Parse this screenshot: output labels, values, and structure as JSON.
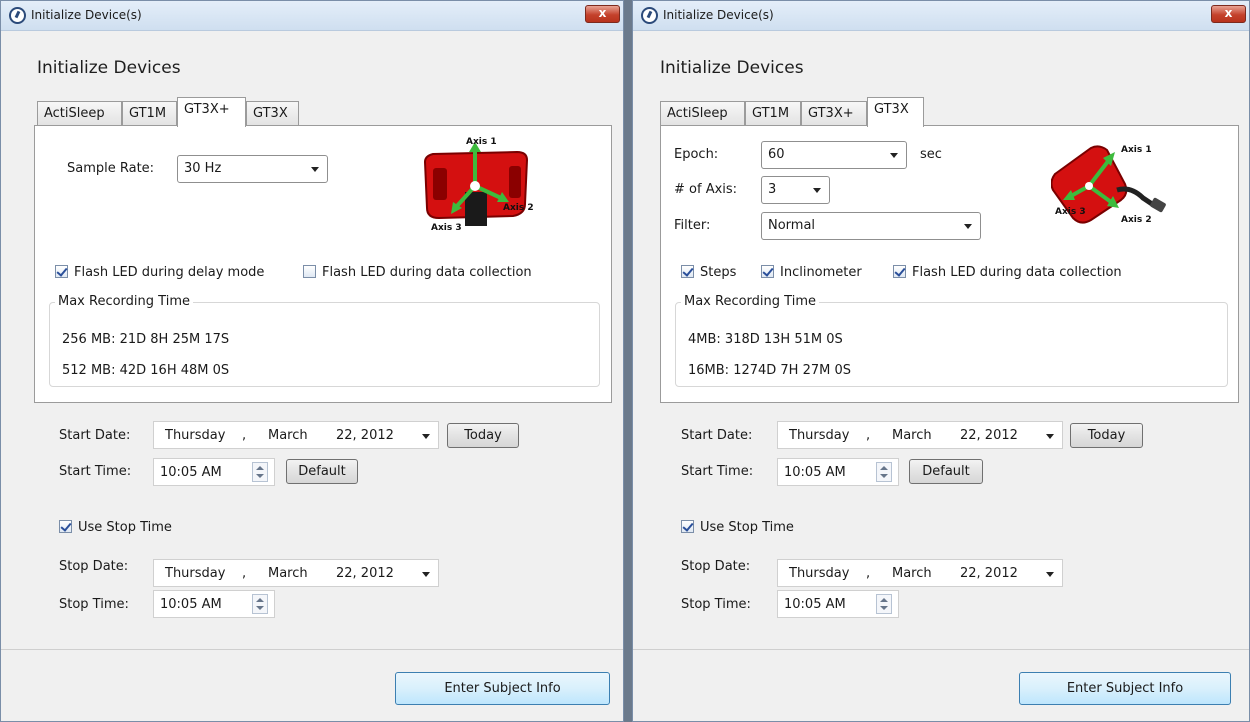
{
  "colors": {
    "accent": "#2a4f9a",
    "device_red": "#d41010",
    "axis_green": "#3dbb3d"
  },
  "icons": {
    "app": "actigraph-logo-icon",
    "close": "close-icon",
    "device": "device-axes-image"
  },
  "windows": [
    {
      "title": "Initialize Device(s)",
      "close": "x",
      "heading": "Initialize Devices",
      "tabs": [
        "ActiSleep",
        "GT1M",
        "GT3X+",
        "GT3X"
      ],
      "active_tab": "GT3X+",
      "settings": {
        "sample_rate_label": "Sample Rate:",
        "sample_rate_value": "30 Hz"
      },
      "device_axes": {
        "axis1": "Axis 1",
        "axis2": "Axis 2",
        "axis3": "Axis 3"
      },
      "checkboxes": [
        {
          "label": "Flash LED during delay mode",
          "checked": true
        },
        {
          "label": "Flash LED during data collection",
          "checked": false
        }
      ],
      "max_recording": {
        "title": "Max Recording Time",
        "lines": [
          "256 MB: 21D 8H 25M 17S",
          "512 MB: 42D 16H 48M 0S"
        ]
      },
      "start_date": {
        "label": "Start Date:",
        "day": "Thursday",
        "sep": ",",
        "month": "March",
        "date": "22, 2012",
        "button": "Today"
      },
      "start_time": {
        "label": "Start Time:",
        "value": "10:05 AM",
        "button": "Default"
      },
      "use_stop_time": {
        "label": "Use Stop Time",
        "checked": true
      },
      "stop_date": {
        "label": "Stop Date:",
        "day": "Thursday",
        "sep": ",",
        "month": "March",
        "date": "22, 2012"
      },
      "stop_time": {
        "label": "Stop Time:",
        "value": "10:05 AM"
      },
      "enter_button": "Enter Subject Info"
    },
    {
      "title": "Initialize Device(s)",
      "close": "x",
      "heading": "Initialize Devices",
      "tabs": [
        "ActiSleep",
        "GT1M",
        "GT3X+",
        "GT3X"
      ],
      "active_tab": "GT3X",
      "settings": {
        "epoch_label": "Epoch:",
        "epoch_value": "60",
        "epoch_unit": "sec",
        "axis_label": "# of Axis:",
        "axis_value": "3",
        "filter_label": "Filter:",
        "filter_value": "Normal"
      },
      "device_axes": {
        "axis1": "Axis 1",
        "axis2": "Axis 2",
        "axis3": "Axis 3"
      },
      "checkboxes": [
        {
          "label": "Steps",
          "checked": true
        },
        {
          "label": "Inclinometer",
          "checked": true
        },
        {
          "label": "Flash LED during data collection",
          "checked": true
        }
      ],
      "max_recording": {
        "title": "Max Recording Time",
        "lines": [
          "4MB: 318D 13H 51M 0S",
          "16MB: 1274D 7H 27M 0S"
        ]
      },
      "start_date": {
        "label": "Start Date:",
        "day": "Thursday",
        "sep": ",",
        "month": "March",
        "date": "22, 2012",
        "button": "Today"
      },
      "start_time": {
        "label": "Start Time:",
        "value": "10:05 AM",
        "button": "Default"
      },
      "use_stop_time": {
        "label": "Use Stop Time",
        "checked": true
      },
      "stop_date": {
        "label": "Stop Date:",
        "day": "Thursday",
        "sep": ",",
        "month": "March",
        "date": "22, 2012"
      },
      "stop_time": {
        "label": "Stop Time:",
        "value": "10:05 AM"
      },
      "enter_button": "Enter Subject Info"
    }
  ]
}
